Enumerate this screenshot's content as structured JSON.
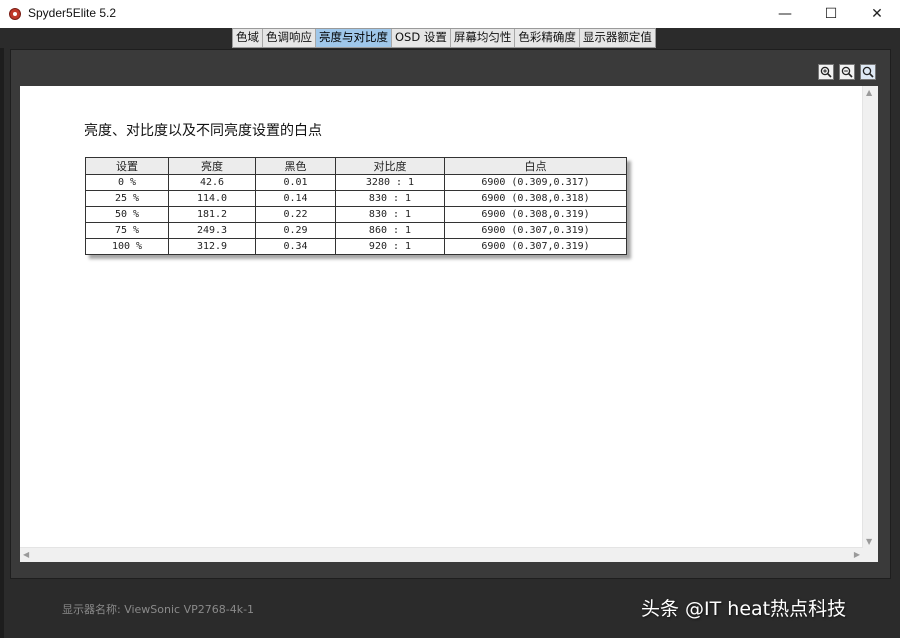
{
  "window": {
    "title": "Spyder5Elite 5.2",
    "min_label": "—",
    "max_label": "☐",
    "close_label": "✕"
  },
  "tabs": [
    {
      "label": "色域",
      "active": false
    },
    {
      "label": "色调响应",
      "active": false
    },
    {
      "label": "亮度与对比度",
      "active": true
    },
    {
      "label": "OSD 设置",
      "active": false
    },
    {
      "label": "屏幕均匀性",
      "active": false
    },
    {
      "label": "色彩精确度",
      "active": false
    },
    {
      "label": "显示器额定值",
      "active": false
    }
  ],
  "zoom": {
    "icons": [
      "zoom-in-icon",
      "zoom-out-icon",
      "zoom-fit-icon"
    ]
  },
  "report": {
    "title": "亮度、对比度以及不同亮度设置的白点",
    "columns": [
      "设置",
      "亮度",
      "黑色",
      "对比度",
      "白点"
    ],
    "rows": [
      [
        "0 %",
        "42.6",
        "0.01",
        "3280 : 1",
        "6900 (0.309,0.317)"
      ],
      [
        "25 %",
        "114.0",
        "0.14",
        "830 : 1",
        "6900 (0.308,0.318)"
      ],
      [
        "50 %",
        "181.2",
        "0.22",
        "830 : 1",
        "6900 (0.308,0.319)"
      ],
      [
        "75 %",
        "249.3",
        "0.29",
        "860 : 1",
        "6900 (0.307,0.319)"
      ],
      [
        "100 %",
        "312.9",
        "0.34",
        "920 : 1",
        "6900 (0.307,0.319)"
      ]
    ]
  },
  "footer": {
    "monitor_name": "显示器名称: ViewSonic VP2768-4k-1"
  },
  "watermark": "头条 @IT heat热点科技",
  "colors": {
    "active_tab": "#9fc7ea",
    "background": "#2b2b2b",
    "content": "#ffffff"
  }
}
